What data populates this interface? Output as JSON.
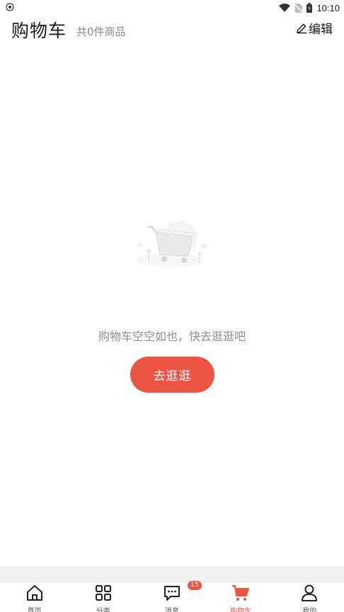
{
  "status_bar": {
    "time": "10:10",
    "icons": [
      "shield-icon",
      "wifi-icon",
      "no-sim-icon",
      "battery-icon"
    ]
  },
  "header": {
    "title": "购物车",
    "count_text": "共0件商品",
    "edit_label": "编辑"
  },
  "empty_state": {
    "illustration": "empty-cart-illustration",
    "message": "购物车空空如也，快去逛逛吧",
    "button_label": "去逛逛"
  },
  "tab_bar": {
    "active_color": "#ec5543",
    "items": [
      {
        "label": "首页",
        "icon": "home-icon",
        "active": false
      },
      {
        "label": "分类",
        "icon": "grid-icon",
        "active": false
      },
      {
        "label": "消息",
        "icon": "message-icon",
        "active": false,
        "badge": "15"
      },
      {
        "label": "购物车",
        "icon": "cart-icon",
        "active": true
      },
      {
        "label": "我的",
        "icon": "user-icon",
        "active": false
      }
    ]
  }
}
